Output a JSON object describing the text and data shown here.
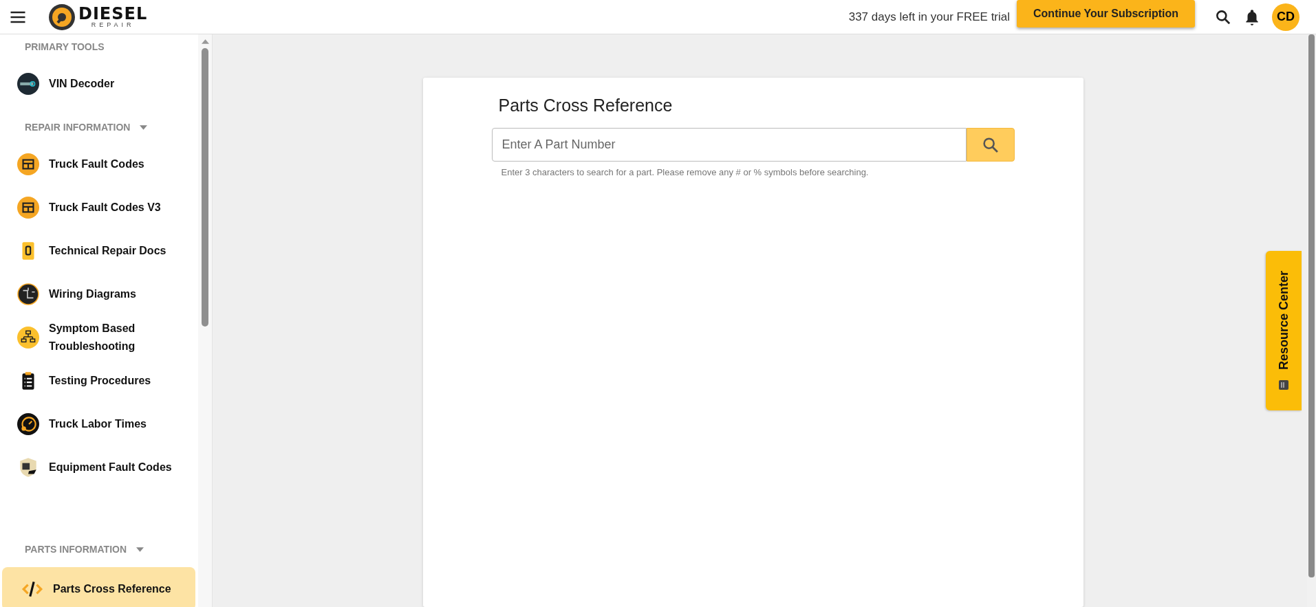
{
  "header": {
    "logo": {
      "title": "DIESEL",
      "subtitle": "REPAIR"
    },
    "trial_text": "337 days left in your FREE trial",
    "subscribe_button": "Continue Your Subscription",
    "avatar": "CD"
  },
  "sidebar": {
    "sections": [
      {
        "title": "PRIMARY TOOLS",
        "caret": false,
        "items": [
          {
            "label": "VIN Decoder",
            "selected": false
          }
        ]
      },
      {
        "title": "REPAIR INFORMATION",
        "caret": true,
        "items": [
          {
            "label": "Truck Fault Codes",
            "selected": false
          },
          {
            "label": "Truck Fault Codes V3",
            "selected": false
          },
          {
            "label": "Technical Repair Docs",
            "selected": false
          },
          {
            "label": "Wiring Diagrams",
            "selected": false
          },
          {
            "label": "Symptom Based Troubleshooting",
            "selected": false
          },
          {
            "label": "Testing Procedures",
            "selected": false
          },
          {
            "label": "Truck Labor Times",
            "selected": false
          },
          {
            "label": "Equipment Fault Codes",
            "selected": false
          }
        ]
      },
      {
        "title": "PARTS INFORMATION",
        "caret": true,
        "items": [
          {
            "label": "Parts Cross Reference",
            "selected": true
          }
        ]
      }
    ]
  },
  "main": {
    "title": "Parts Cross Reference",
    "search": {
      "placeholder": "Enter A Part Number"
    },
    "hint": "Enter 3 characters to search for a part. Please remove any # or % symbols before searching."
  },
  "resource_center": {
    "label": "Resource Center"
  }
}
